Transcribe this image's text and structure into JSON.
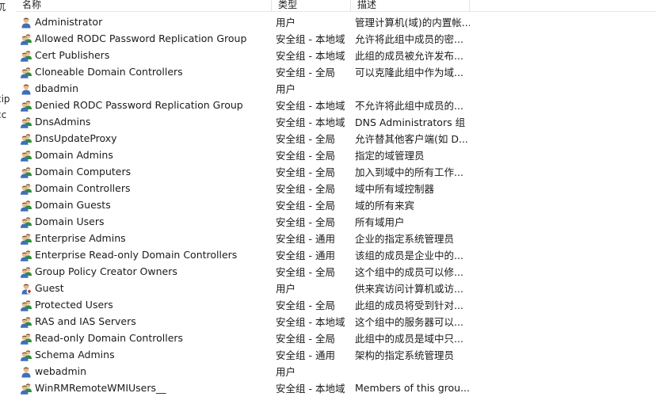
{
  "left_edge": [
    "杌",
    "cip",
    "cc"
  ],
  "columns": {
    "name": "名称",
    "type": "类型",
    "desc": "描述"
  },
  "rows": [
    {
      "name": "Administrator",
      "type": "用户",
      "desc": "管理计算机(域)的内置帐...",
      "icon": "user-icon"
    },
    {
      "name": "Allowed RODC Password Replication Group",
      "type": "安全组 - 本地域",
      "desc": "允许将此组中成员的密...",
      "icon": "group-icon"
    },
    {
      "name": "Cert Publishers",
      "type": "安全组 - 本地域",
      "desc": "此组的成员被允许发布...",
      "icon": "group-icon"
    },
    {
      "name": "Cloneable Domain Controllers",
      "type": "安全组 - 全局",
      "desc": "可以克隆此组中作为域...",
      "icon": "group-icon"
    },
    {
      "name": "dbadmin",
      "type": "用户",
      "desc": "",
      "icon": "user-icon"
    },
    {
      "name": "Denied RODC Password Replication Group",
      "type": "安全组 - 本地域",
      "desc": "不允许将此组中成员的...",
      "icon": "group-icon"
    },
    {
      "name": "DnsAdmins",
      "type": "安全组 - 本地域",
      "desc": "DNS Administrators 组",
      "icon": "group-icon"
    },
    {
      "name": "DnsUpdateProxy",
      "type": "安全组 - 全局",
      "desc": "允许替其他客户端(如 D...",
      "icon": "group-icon"
    },
    {
      "name": "Domain Admins",
      "type": "安全组 - 全局",
      "desc": "指定的域管理员",
      "icon": "group-icon"
    },
    {
      "name": "Domain Computers",
      "type": "安全组 - 全局",
      "desc": "加入到域中的所有工作...",
      "icon": "group-icon"
    },
    {
      "name": "Domain Controllers",
      "type": "安全组 - 全局",
      "desc": "域中所有域控制器",
      "icon": "group-icon"
    },
    {
      "name": "Domain Guests",
      "type": "安全组 - 全局",
      "desc": "域的所有来宾",
      "icon": "group-icon"
    },
    {
      "name": "Domain Users",
      "type": "安全组 - 全局",
      "desc": "所有域用户",
      "icon": "group-icon"
    },
    {
      "name": "Enterprise Admins",
      "type": "安全组 - 通用",
      "desc": "企业的指定系统管理员",
      "icon": "group-icon"
    },
    {
      "name": "Enterprise Read-only Domain Controllers",
      "type": "安全组 - 通用",
      "desc": "该组的成员是企业中的...",
      "icon": "group-icon"
    },
    {
      "name": "Group Policy Creator Owners",
      "type": "安全组 - 全局",
      "desc": "这个组中的成员可以修...",
      "icon": "group-icon"
    },
    {
      "name": "Guest",
      "type": "用户",
      "desc": "供来宾访问计算机或访...",
      "icon": "disabled-user-icon"
    },
    {
      "name": "Protected Users",
      "type": "安全组 - 全局",
      "desc": "此组的成员将受到针对...",
      "icon": "group-icon"
    },
    {
      "name": "RAS and IAS Servers",
      "type": "安全组 - 本地域",
      "desc": "这个组中的服务器可以...",
      "icon": "group-icon"
    },
    {
      "name": "Read-only Domain Controllers",
      "type": "安全组 - 全局",
      "desc": "此组中的成员是域中只...",
      "icon": "group-icon"
    },
    {
      "name": "Schema Admins",
      "type": "安全组 - 通用",
      "desc": "架构的指定系统管理员",
      "icon": "group-icon"
    },
    {
      "name": "webadmin",
      "type": "用户",
      "desc": "",
      "icon": "user-icon"
    },
    {
      "name": "WinRMRemoteWMIUsers__",
      "type": "安全组 - 本地域",
      "desc": "Members of this grou...",
      "icon": "group-icon"
    }
  ],
  "colors": {
    "user_shirt": "#3f6fb8",
    "group_back": "#2f8f3a",
    "skin": "#e8b98c",
    "hair": "#6b4a2a",
    "disabled": "#c0392b"
  }
}
